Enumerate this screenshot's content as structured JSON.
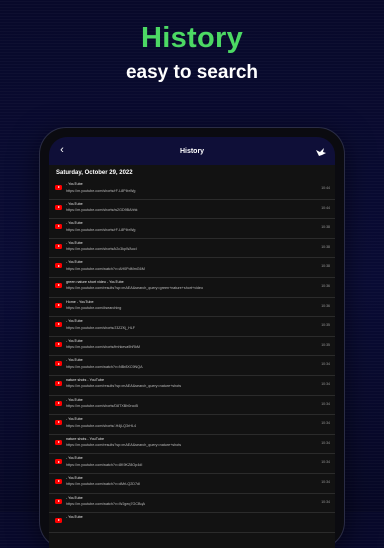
{
  "hero": {
    "title": "History",
    "subtitle": "easy to search"
  },
  "app_bar": {
    "back_glyph": "‹",
    "title": "History",
    "right_icon": "bird-icon"
  },
  "date_header": "Saturday, October 29, 2022",
  "items": [
    {
      "title": "- YouTube",
      "url": "https://m.youtube.com/shorts/rF-L8PIbrWg",
      "time": "10:44"
    },
    {
      "title": "- YouTube",
      "url": "https://m.youtube.com/shorts/w2GD9BAhhk",
      "time": "10:44"
    },
    {
      "title": "- YouTube",
      "url": "https://m.youtube.com/shorts/rF-L8PIbrWg",
      "time": "10:38"
    },
    {
      "title": "- YouTube",
      "url": "https://m.youtube.com/shorts/k2c3kpWAocI",
      "time": "10:38"
    },
    {
      "title": "- YouTube",
      "url": "https://m.youtube.com/watch?v=AH0PdMmG6M",
      "time": "10:38"
    },
    {
      "title": "green nature short video - YouTube",
      "url": "https://m.youtube.com/results?sp=mAEA&search_query=green+nature+short+video",
      "time": "10:36"
    },
    {
      "title": "Home - YouTube",
      "url": "https://m.youtube.com/#searching",
      "time": "10:36"
    },
    {
      "title": "- YouTube",
      "url": "https://m.youtube.com/shorts/J3ZZKj_HLF",
      "time": "10:35"
    },
    {
      "title": "- YouTube",
      "url": "https://m.youtube.com/shorts/fmhkeva9hRkM",
      "time": "10:35"
    },
    {
      "title": "- YouTube",
      "url": "https://m.youtube.com/watch?v=NBr8XC9NQA",
      "time": "10:34"
    },
    {
      "title": "nature shots - YouTube",
      "url": "https://m.youtube.com/results?sp=mAEA&search_query=nature+shots",
      "time": "10:34"
    },
    {
      "title": "- YouTube",
      "url": "https://m.youtube.com/shorts/D8TXBh0rcoB",
      "time": "10:34"
    },
    {
      "title": "- YouTube",
      "url": "https://m.youtube.com/shorts/-H4jLQ3rHL4",
      "time": "10:34"
    },
    {
      "title": "nature shots - YouTube",
      "url": "https://m.youtube.com/results?sp=mAEA&search_query=nature+shots",
      "time": "10:34"
    },
    {
      "title": "- YouTube",
      "url": "https://m.youtube.com/watch?v=8K9KZ8Op4dI",
      "time": "10:34"
    },
    {
      "title": "- YouTube",
      "url": "https://m.youtube.com/watch?v=dMrLQ2D7dI",
      "time": "10:34"
    },
    {
      "title": "- YouTube",
      "url": "https://m.youtube.com/watch?v=WJgeq7GCBqA",
      "time": "10:34"
    },
    {
      "title": "- YouTube",
      "url": "",
      "time": ""
    }
  ]
}
